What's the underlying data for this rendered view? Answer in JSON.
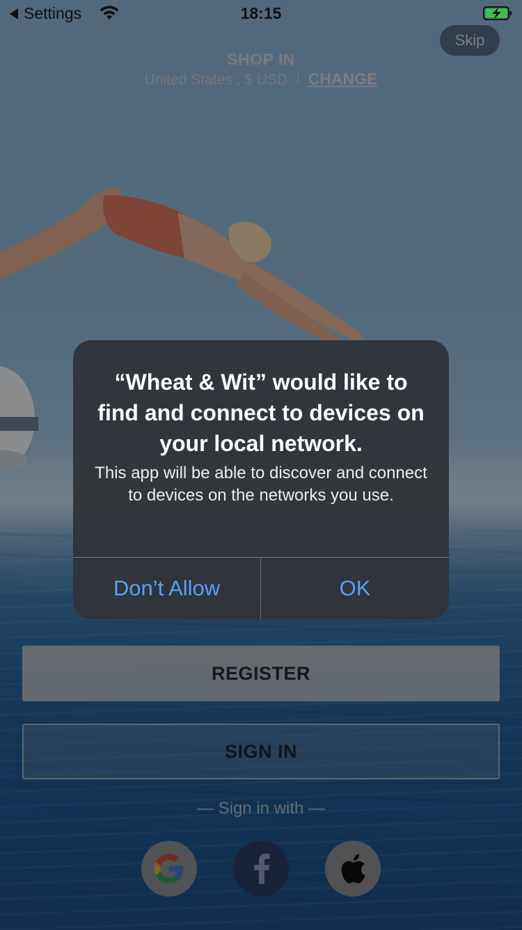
{
  "status_bar": {
    "back_label": "Settings",
    "time": "18:15"
  },
  "header": {
    "skip_label": "Skip",
    "shop_title": "SHOP IN",
    "region": "United States , $ USD",
    "separator": "I",
    "change_label": "CHANGE"
  },
  "alert": {
    "title": "“Wheat & Wit” would like to find and connect to devices on your local network.",
    "message": "This app will be able to discover and connect to devices on the networks you use.",
    "deny_label": "Don’t Allow",
    "ok_label": "OK",
    "button_color": "#5aa0f5"
  },
  "actions": {
    "register_label": "REGISTER",
    "signin_label": "SIGN IN",
    "signin_with": "— Sign in with —"
  },
  "social": [
    {
      "icon": "google-icon"
    },
    {
      "icon": "facebook-icon"
    },
    {
      "icon": "apple-icon"
    }
  ]
}
